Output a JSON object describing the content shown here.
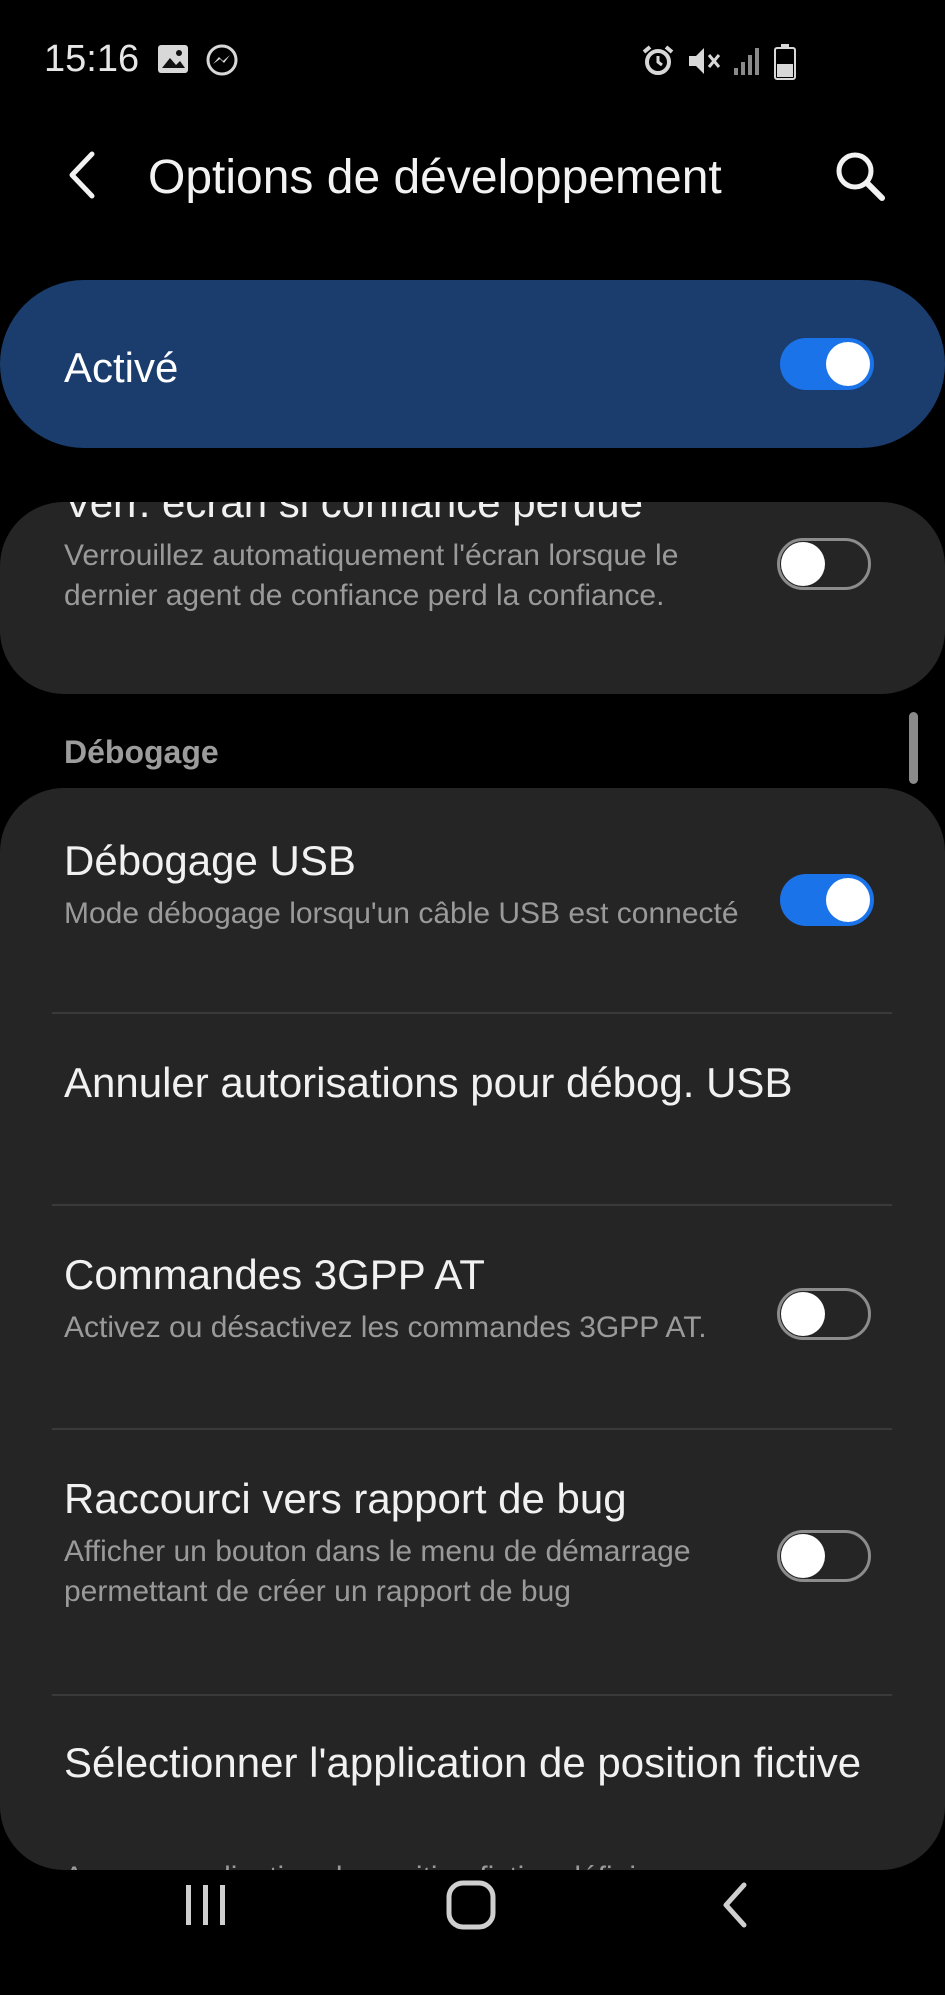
{
  "status_bar": {
    "time": "15:16",
    "left_icons": [
      "image-icon",
      "messenger-icon"
    ],
    "right_icons": [
      "alarm-icon",
      "vibrate-off-icon",
      "signal-icon",
      "battery-icon"
    ]
  },
  "header": {
    "title": "Options de développement",
    "back_icon": "back-arrow-icon",
    "search_icon": "search-icon"
  },
  "master_switch": {
    "label": "Activé",
    "state": "on"
  },
  "top_card": {
    "partial_title": "Verr. écran si confiance perdue",
    "subtitle": "Verrouillez automatiquement l'écran lorsque le dernier agent de confiance perd la confiance.",
    "toggle": "off"
  },
  "section": {
    "debug_header": "Débogage"
  },
  "debug_items": [
    {
      "title": "Débogage USB",
      "subtitle": "Mode débogage lorsqu'un câble USB est connecté",
      "toggle": "on"
    },
    {
      "title": "Annuler autorisations pour débog. USB",
      "subtitle": "",
      "toggle": "none"
    },
    {
      "title": "Commandes 3GPP AT",
      "subtitle": "Activez ou désactivez les commandes 3GPP AT.",
      "toggle": "off"
    },
    {
      "title": "Raccourci vers rapport de bug",
      "subtitle": "Afficher un bouton dans le menu de démarrage permettant de créer un rapport de bug",
      "toggle": "off"
    },
    {
      "title": "Sélectionner l'application de position fictive",
      "subtitle": "Aucune application de position fictive définie",
      "toggle": "none"
    }
  ],
  "nav_bar": {
    "items": [
      "recents-icon",
      "home-icon",
      "back-icon"
    ]
  },
  "colors": {
    "accent": "#1a73e8",
    "master_card": "#1b3d6d",
    "card": "#252525",
    "background": "#000000"
  }
}
